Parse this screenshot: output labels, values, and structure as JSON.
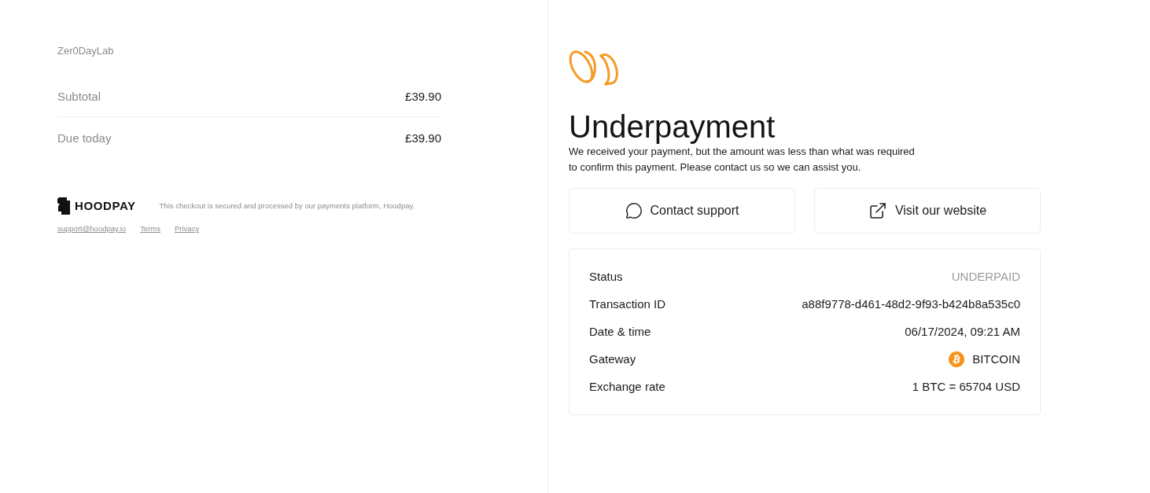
{
  "merchant": {
    "name": "Zer0DayLab"
  },
  "summary": [
    {
      "label": "Subtotal",
      "amount": "£39.90"
    },
    {
      "label": "Due today",
      "amount": "£39.90"
    }
  ],
  "footer": {
    "brand": "HOODPAY",
    "note": "This checkout is secured and processed by our payments platform, Hoodpay.",
    "links": [
      "support@hoodpay.io",
      "Terms",
      "Privacy"
    ]
  },
  "result": {
    "title": "Underpayment",
    "message": "We received your payment, but the amount was less than what was required to confirm this payment. Please contact us so we can assist you.",
    "actions": [
      {
        "kind": "chat",
        "label": "Contact support"
      },
      {
        "kind": "external",
        "label": "Visit our website"
      }
    ]
  },
  "details": [
    {
      "kind": "status",
      "label": "Status",
      "value": "UNDERPAID"
    },
    {
      "kind": "text",
      "label": "Transaction ID",
      "value": "a88f9778-d461-48d2-9f93-b424b8a535c0"
    },
    {
      "kind": "text",
      "label": "Date & time",
      "value": "06/17/2024, 09:21 AM"
    },
    {
      "kind": "gateway",
      "label": "Gateway",
      "value": "BITCOIN"
    },
    {
      "kind": "text",
      "label": "Exchange rate",
      "value": "1 BTC = 65704 USD"
    }
  ]
}
